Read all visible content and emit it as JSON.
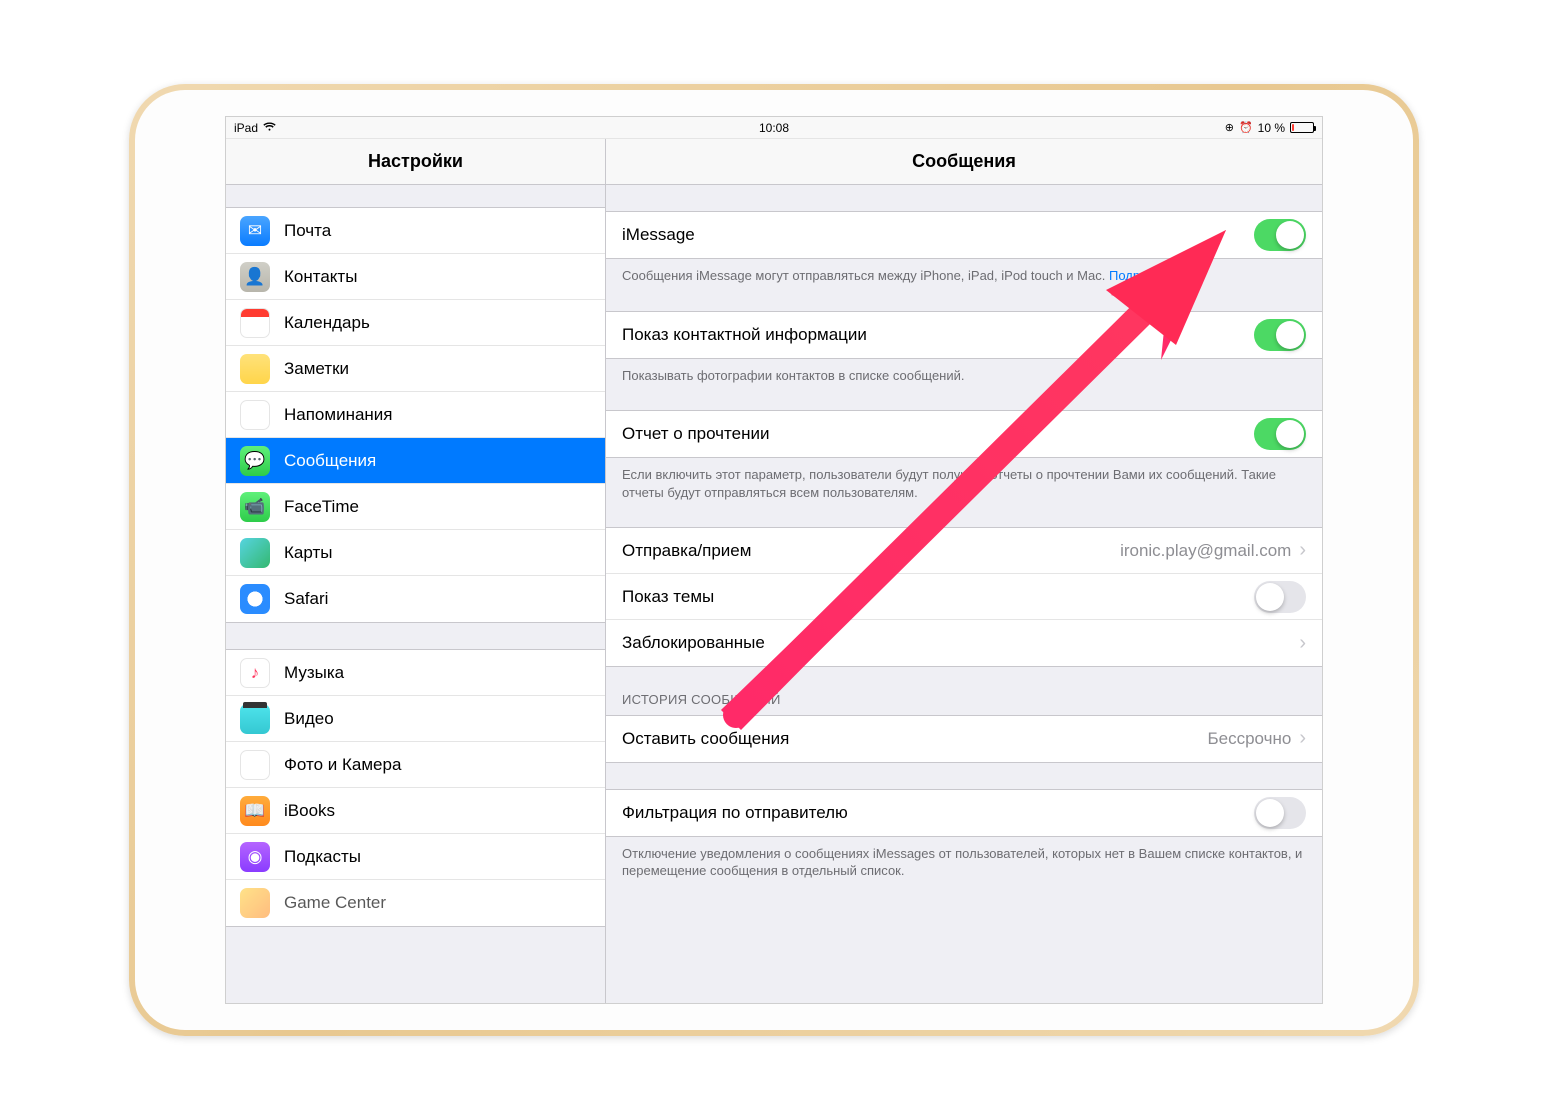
{
  "status": {
    "carrier": "iPad",
    "time": "10:08",
    "battery_text": "10 %",
    "battery_percent": 10
  },
  "sidebar": {
    "title": "Настройки",
    "groups": [
      {
        "items": [
          {
            "icon": "mail-icon",
            "label": "Почта"
          },
          {
            "icon": "contacts-icon",
            "label": "Контакты"
          },
          {
            "icon": "calendar-icon",
            "label": "Календарь"
          },
          {
            "icon": "notes-icon",
            "label": "Заметки"
          },
          {
            "icon": "reminders-icon",
            "label": "Напоминания"
          },
          {
            "icon": "messages-icon",
            "label": "Сообщения",
            "selected": true
          },
          {
            "icon": "facetime-icon",
            "label": "FaceTime"
          },
          {
            "icon": "maps-icon",
            "label": "Карты"
          },
          {
            "icon": "safari-icon",
            "label": "Safari"
          }
        ]
      },
      {
        "items": [
          {
            "icon": "music-icon",
            "label": "Музыка"
          },
          {
            "icon": "video-icon",
            "label": "Видео"
          },
          {
            "icon": "photos-icon",
            "label": "Фото и Камера"
          },
          {
            "icon": "ibooks-icon",
            "label": "iBooks"
          },
          {
            "icon": "podcasts-icon",
            "label": "Подкасты"
          },
          {
            "icon": "gamecenter-icon",
            "label": "Game Center"
          }
        ]
      }
    ]
  },
  "detail": {
    "title": "Сообщения",
    "imessage": {
      "label": "iMessage",
      "on": true,
      "footer": "Сообщения iMessage могут отправляться между iPhone, iPad, iPod touch и Mac.",
      "more": "Подробнее…"
    },
    "contact_info": {
      "label": "Показ контактной информации",
      "on": true,
      "footer": "Показывать фотографии контактов в списке сообщений."
    },
    "read_receipts": {
      "label": "Отчет о прочтении",
      "on": true,
      "footer": "Если включить этот параметр, пользователи будут получать отчеты о прочтении Вами их сообщений. Такие отчеты будут отправляться всем пользователям."
    },
    "send_receive": {
      "label": "Отправка/прием",
      "value": "ironic.play@gmail.com"
    },
    "subject": {
      "label": "Показ темы",
      "on": false
    },
    "blocked": {
      "label": "Заблокированные"
    },
    "history_header": "ИСТОРИЯ СООБЩЕНИЙ",
    "keep_messages": {
      "label": "Оставить сообщения",
      "value": "Бессрочно"
    },
    "filter": {
      "label": "Фильтрация по отправителю",
      "on": false,
      "footer": "Отключение уведомления о сообщениях iMessages от пользователей, которых нет в Вашем списке контактов, и перемещение сообщения в отдельный список."
    }
  }
}
